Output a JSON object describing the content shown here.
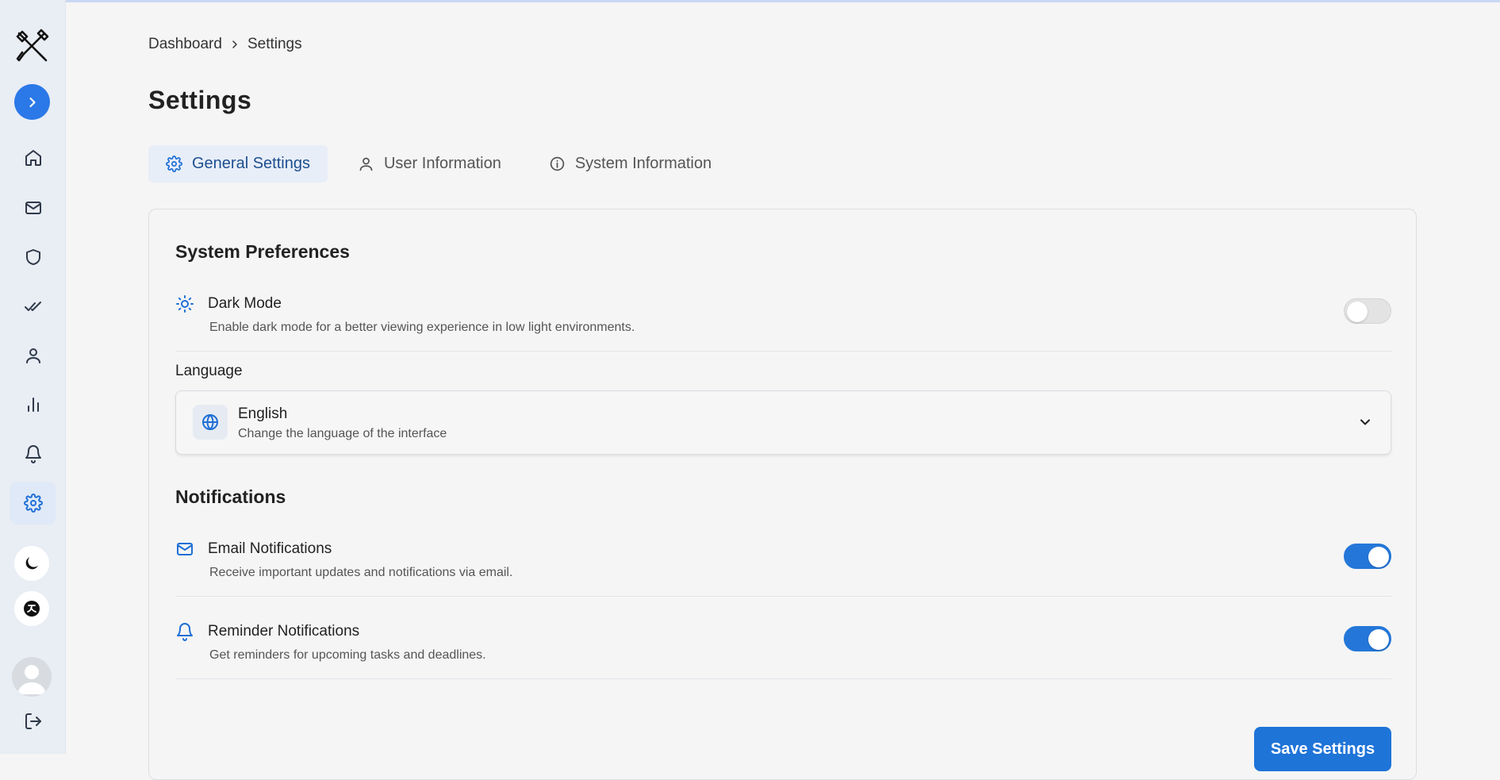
{
  "breadcrumb": {
    "parent": "Dashboard",
    "current": "Settings"
  },
  "page": {
    "title": "Settings"
  },
  "tabs": [
    {
      "label": "General Settings",
      "icon": "gear-icon",
      "active": true
    },
    {
      "label": "User Information",
      "icon": "user-icon",
      "active": false
    },
    {
      "label": "System Information",
      "icon": "info-icon",
      "active": false
    }
  ],
  "sidebar": {
    "items": [
      {
        "name": "home",
        "icon": "home-icon"
      },
      {
        "name": "mail",
        "icon": "mail-icon"
      },
      {
        "name": "security",
        "icon": "shield-icon"
      },
      {
        "name": "tasks",
        "icon": "double-check-icon"
      },
      {
        "name": "users",
        "icon": "user-icon"
      },
      {
        "name": "analytics",
        "icon": "bar-chart-icon"
      },
      {
        "name": "notifications",
        "icon": "bell-icon"
      },
      {
        "name": "settings",
        "icon": "gear-icon",
        "active": true
      }
    ]
  },
  "system_preferences": {
    "title": "System Preferences",
    "dark_mode": {
      "label": "Dark Mode",
      "description": "Enable dark mode for a better viewing experience in low light environments.",
      "enabled": false
    },
    "language": {
      "label": "Language",
      "value": "English",
      "description": "Change the language of the interface"
    }
  },
  "notifications": {
    "title": "Notifications",
    "email": {
      "label": "Email Notifications",
      "description": "Receive important updates and notifications via email.",
      "enabled": true
    },
    "reminder": {
      "label": "Reminder Notifications",
      "description": "Get reminders for upcoming tasks and deadlines.",
      "enabled": true
    }
  },
  "actions": {
    "save_label": "Save Settings"
  },
  "colors": {
    "accent": "#1f74d8",
    "sidebar_bg": "#e9edf4",
    "page_bg": "#f5f5f5"
  }
}
